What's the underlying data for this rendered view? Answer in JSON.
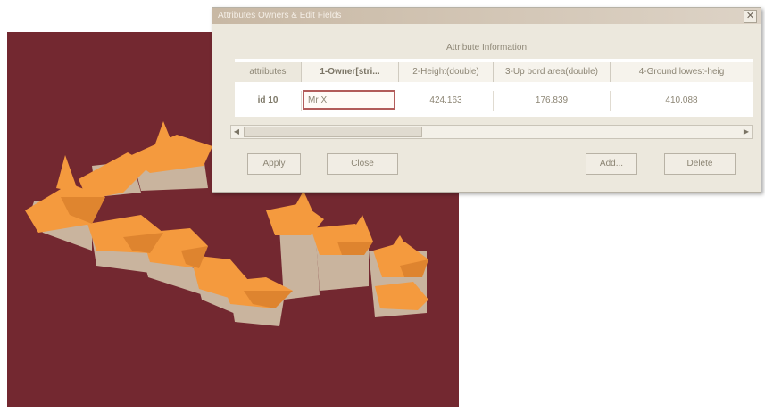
{
  "colors": {
    "viewport_bg": "#732830",
    "roof": "#f39a3f",
    "wall": "#c8b39c",
    "dialog_bg": "#ece8dd"
  },
  "dialog": {
    "title": "Attributes Owners & Edit Fields",
    "close_icon": "close-icon",
    "caption": "Attribute Information",
    "table": {
      "headers": [
        "attributes",
        "1-Owner[stri...",
        "2-Height(double)",
        "3-Up bord area(double)",
        "4-Ground lowest-heig"
      ],
      "row": {
        "id": "id 10",
        "owner": "Mr X",
        "height": "424.163",
        "area": "176.839",
        "ground": "410.088"
      }
    },
    "buttons": {
      "apply": "Apply",
      "close": "Close",
      "add": "Add...",
      "delete": "Delete"
    }
  }
}
